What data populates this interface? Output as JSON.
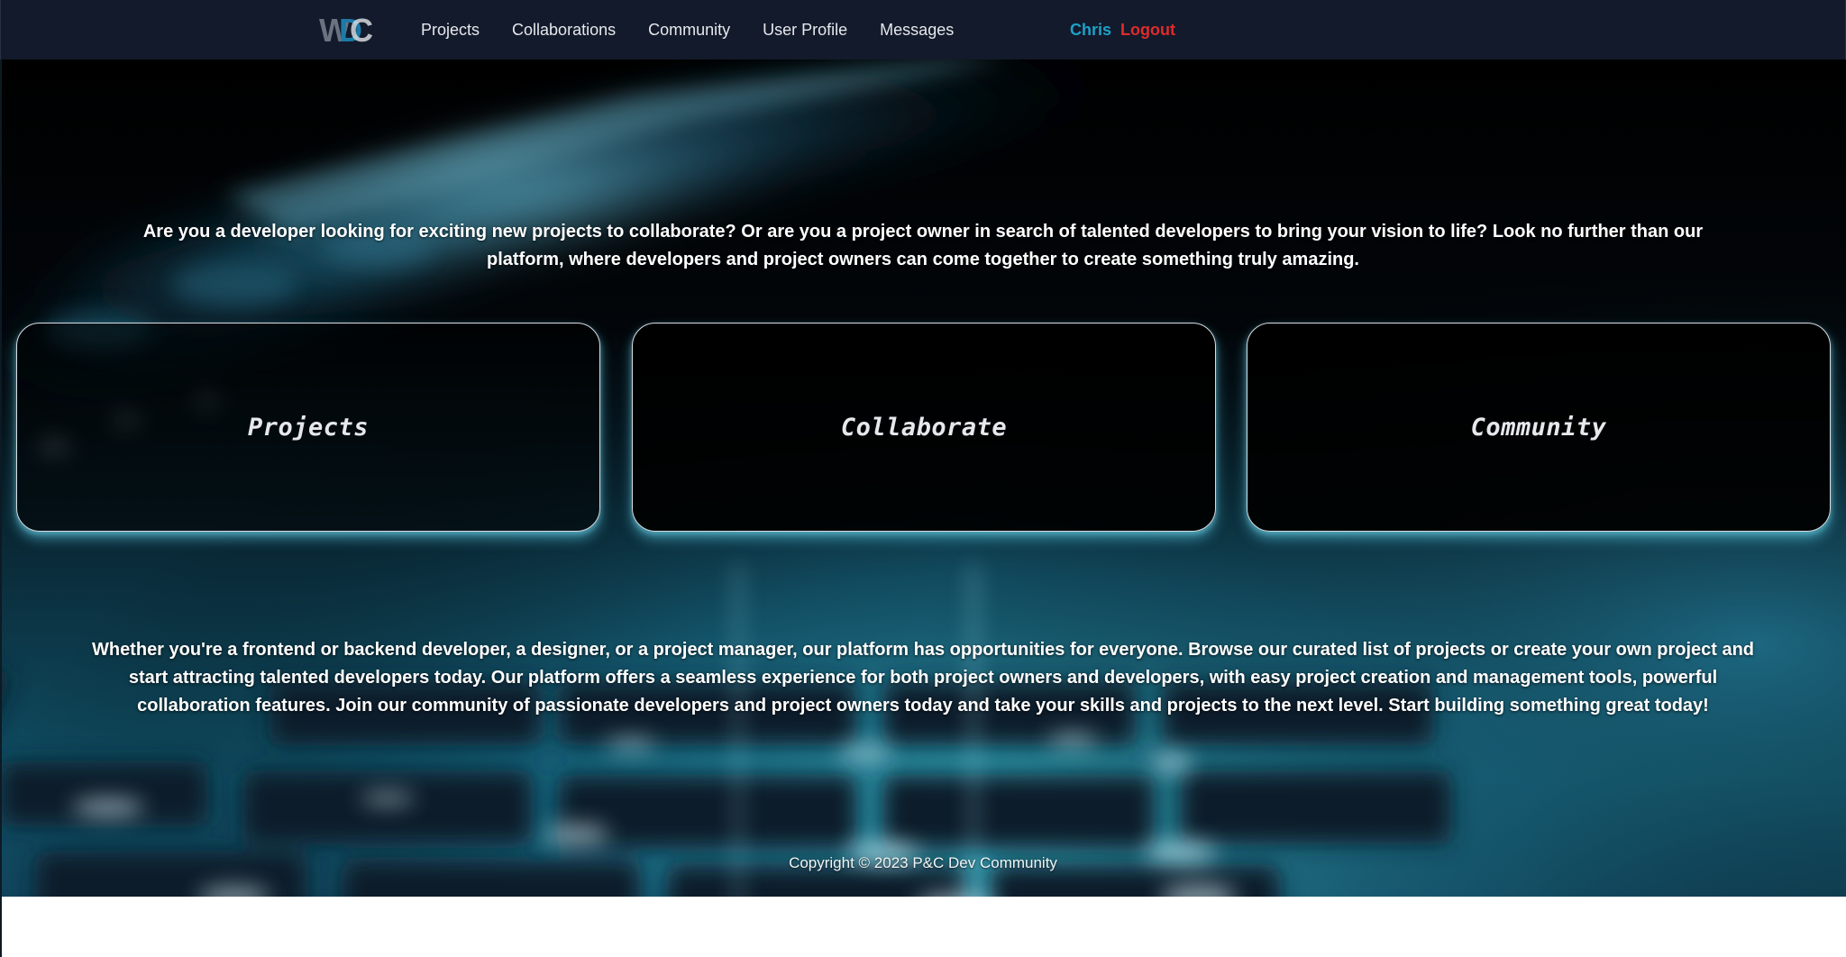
{
  "navbar": {
    "logo_text": "WDC",
    "links": [
      {
        "label": "Projects"
      },
      {
        "label": "Collaborations"
      },
      {
        "label": "Community"
      },
      {
        "label": "User Profile"
      },
      {
        "label": "Messages"
      }
    ],
    "user_name": "Chris",
    "logout_label": "Logout"
  },
  "hero": {
    "intro": "Are you a developer looking for exciting new projects to collaborate? Or are you a project owner in search of talented developers to bring your vision to life? Look no further than our platform, where developers and project owners can come together to create something truly amazing.",
    "cards": [
      {
        "label": "Projects"
      },
      {
        "label": "Collaborate"
      },
      {
        "label": "Community"
      }
    ],
    "body": "Whether you're a frontend or backend developer, a designer, or a project manager, our platform has opportunities for everyone. Browse our curated list of projects or create your own project and start attracting talented developers today. Our platform offers a seamless experience for both project owners and developers, with easy project creation and management tools, powerful collaboration features. Join our community of passionate developers and project owners today and take your skills and projects to the next level. Start building something great today!"
  },
  "footer": {
    "copyright": "Copyright © 2023 P&C Dev Community"
  },
  "colors": {
    "navbar_bg": "#131a2b",
    "user_name": "#1da1c8",
    "logout": "#e02b2b",
    "card_glow": "#5ac8e1"
  }
}
